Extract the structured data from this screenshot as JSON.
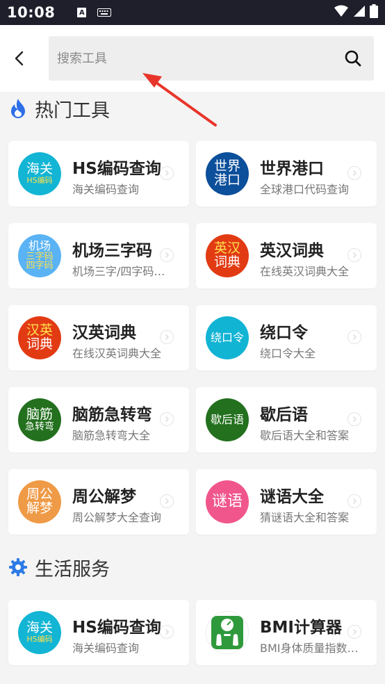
{
  "status_bar": {
    "time": "10:08",
    "a_icon": "A"
  },
  "search": {
    "placeholder": "搜索工具"
  },
  "sections": [
    {
      "title": "热门工具",
      "icon": "fire-icon"
    },
    {
      "title": "生活服务",
      "icon": "gear-icon"
    }
  ],
  "hot_tools": [
    {
      "title": "HS编码查询",
      "subtitle": "海关编码查询",
      "logo": [
        "海关",
        "HS编码"
      ],
      "color": "#13b5d4"
    },
    {
      "title": "世界港口",
      "subtitle": "全球港口代码查询",
      "logo": [
        "世界",
        "港口"
      ],
      "color": "#0c4f9b"
    },
    {
      "title": "机场三字码",
      "subtitle": "机场三字/四字码查询",
      "logo": [
        "机场",
        "三字码",
        "四字码"
      ],
      "color": "#5ab3f4"
    },
    {
      "title": "英汉词典",
      "subtitle": "在线英汉词典大全",
      "logo": [
        "英汉",
        "词典"
      ],
      "color": "#e23b14"
    },
    {
      "title": "汉英词典",
      "subtitle": "在线汉英词典大全",
      "logo": [
        "汉英",
        "词典"
      ],
      "color": "#e23b14"
    },
    {
      "title": "绕口令",
      "subtitle": "绕口令大全",
      "logo": [
        "绕口令"
      ],
      "color": "#12b4d4"
    },
    {
      "title": "脑筋急转弯",
      "subtitle": "脑筋急转弯大全",
      "logo": [
        "脑筋",
        "急转弯"
      ],
      "color": "#23701e"
    },
    {
      "title": "歇后语",
      "subtitle": "歇后语大全和答案",
      "logo": [
        "歇后语"
      ],
      "color": "#23701e"
    },
    {
      "title": "周公解梦",
      "subtitle": "周公解梦大全查询",
      "logo": [
        "周公",
        "解梦"
      ],
      "color": "#ef9a46"
    },
    {
      "title": "谜语大全",
      "subtitle": "猜谜语大全和答案",
      "logo": [
        "谜语"
      ],
      "color": "#f0568c"
    }
  ],
  "life_services": [
    {
      "title": "HS编码查询",
      "subtitle": "海关编码查询",
      "logo": [
        "海关",
        "HS编码"
      ],
      "color": "#13b5d4"
    },
    {
      "title": "BMI计算器",
      "subtitle": "BMI身体质量指数计算",
      "logo": [],
      "color": "#ffffff"
    }
  ],
  "colors": {
    "accent_blue": "#2d7be5",
    "fire": "#2e6fe8",
    "status_bg": "#1e1f2b",
    "arrow": "#e8352a"
  }
}
